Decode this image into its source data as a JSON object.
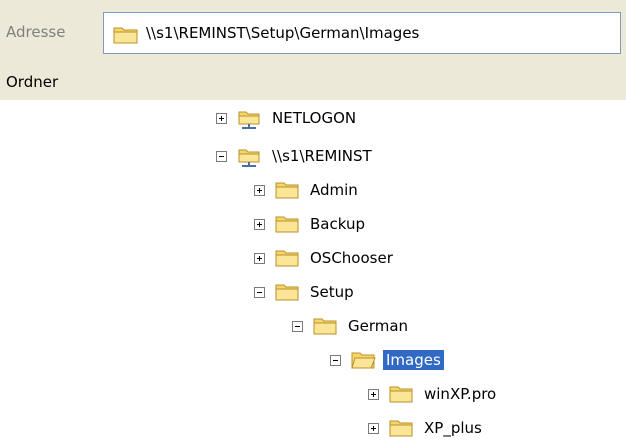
{
  "address": {
    "label": "Adresse",
    "path": "\\\\s1\\REMINST\\Setup\\German\\Images"
  },
  "header": {
    "title": "Ordner"
  },
  "tree": {
    "nodes": [
      {
        "label": "NETLOGON",
        "icon": "network-share-icon",
        "expander": "plus"
      },
      {
        "label": "\\\\s1\\REMINST",
        "icon": "network-share-icon",
        "expander": "minus"
      },
      {
        "label": "Admin",
        "icon": "folder-icon",
        "expander": "plus"
      },
      {
        "label": "Backup",
        "icon": "folder-icon",
        "expander": "plus"
      },
      {
        "label": "OSChooser",
        "icon": "folder-icon",
        "expander": "plus"
      },
      {
        "label": "Setup",
        "icon": "folder-icon",
        "expander": "minus"
      },
      {
        "label": "German",
        "icon": "folder-icon",
        "expander": "minus"
      },
      {
        "label": "Images",
        "icon": "open-folder-icon",
        "expander": "minus",
        "selected": true
      },
      {
        "label": "winXP.pro",
        "icon": "folder-icon",
        "expander": "plus"
      },
      {
        "label": "XP_plus",
        "icon": "folder-icon",
        "expander": "plus"
      }
    ]
  },
  "colors": {
    "selection": "#316ac5",
    "toolbar": "#ece9d8",
    "folder": "#f6d56b"
  }
}
